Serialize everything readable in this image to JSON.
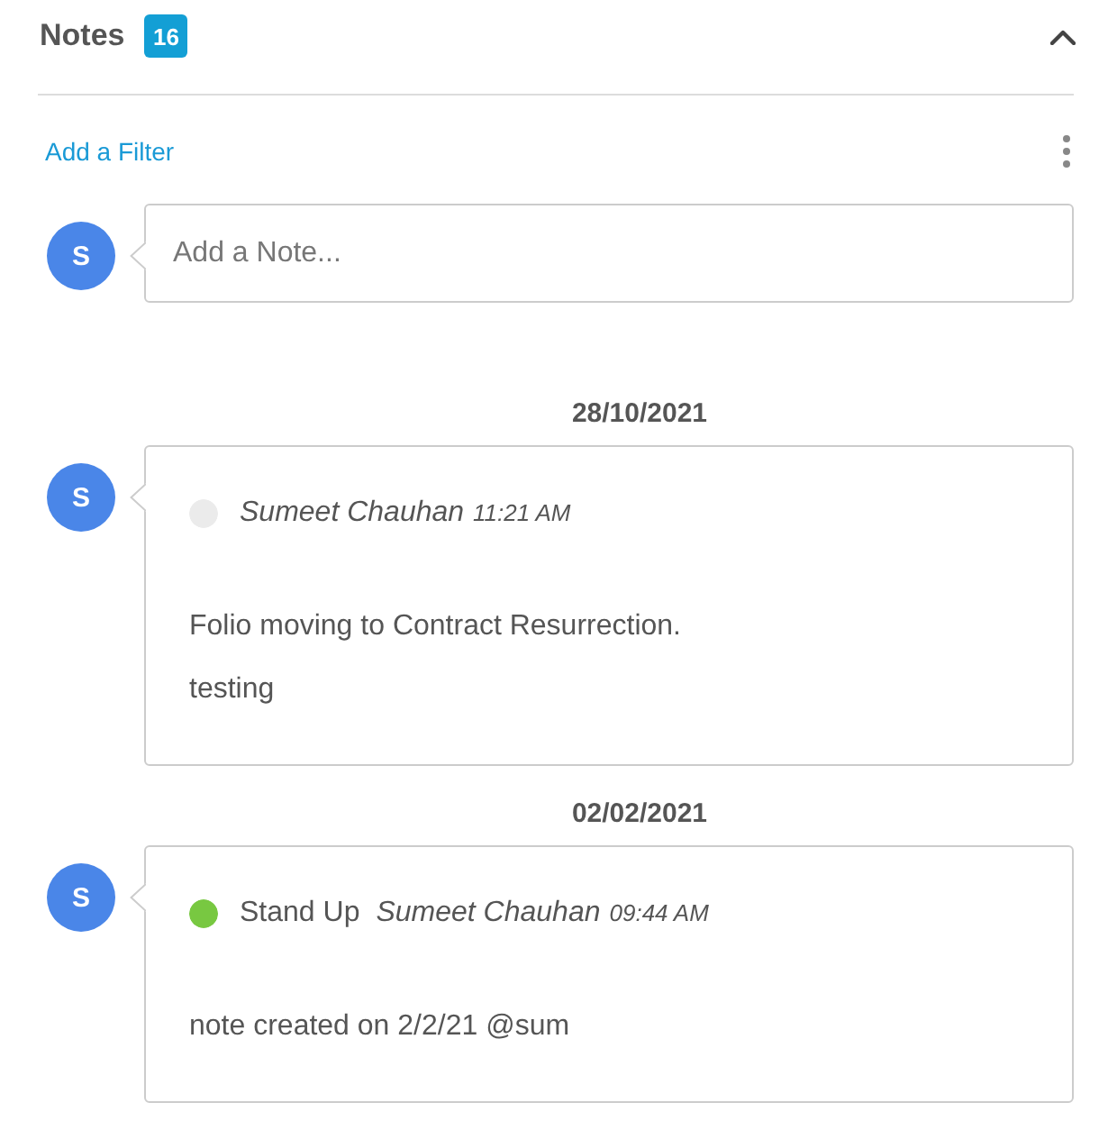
{
  "header": {
    "title": "Notes",
    "count": "16",
    "expanded": true
  },
  "toolbar": {
    "filter_link": "Add a Filter"
  },
  "composer": {
    "avatar": "S",
    "placeholder": "Add a Note..."
  },
  "notes": [
    {
      "date": "28/10/2021",
      "avatar": "S",
      "color": "#ebebeb",
      "author": "Sumeet Chauhan",
      "time": "11:21 AM",
      "body": [
        "Folio moving to Contract Resurrection.",
        "testing"
      ]
    },
    {
      "date": "02/02/2021",
      "avatar": "S",
      "color": "#78c841",
      "category": "Stand Up",
      "author": "Sumeet Chauhan",
      "time": "09:44 AM",
      "body": [
        "note created on 2/2/21 @sum"
      ]
    }
  ]
}
